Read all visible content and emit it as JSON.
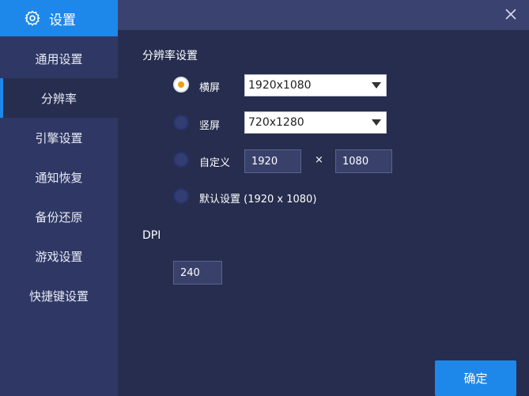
{
  "header": {
    "title": "设置",
    "icon": "gear-icon"
  },
  "sidebar": {
    "items": [
      {
        "label": "通用设置",
        "active": false
      },
      {
        "label": "分辨率",
        "active": true
      },
      {
        "label": "引擎设置",
        "active": false
      },
      {
        "label": "通知恢复",
        "active": false
      },
      {
        "label": "备份还原",
        "active": false
      },
      {
        "label": "游戏设置",
        "active": false
      },
      {
        "label": "快捷键设置",
        "active": false
      }
    ]
  },
  "resolution": {
    "section_title": "分辨率设置",
    "landscape": {
      "label": "横屏",
      "value": "1920x1080",
      "checked": true
    },
    "portrait": {
      "label": "竖屏",
      "value": "720x1280",
      "checked": false
    },
    "custom": {
      "label": "自定义",
      "width": "1920",
      "height": "1080",
      "separator": "×",
      "checked": false
    },
    "default": {
      "label": "默认设置 (1920 x 1080)",
      "checked": false
    }
  },
  "dpi": {
    "label": "DPI",
    "value": "240"
  },
  "footer": {
    "confirm_label": "确定"
  },
  "colors": {
    "accent": "#1e88ea",
    "radio_dot": "#f39c12",
    "panel_bg": "#262d4e",
    "sidebar_bg": "#2f3864"
  }
}
